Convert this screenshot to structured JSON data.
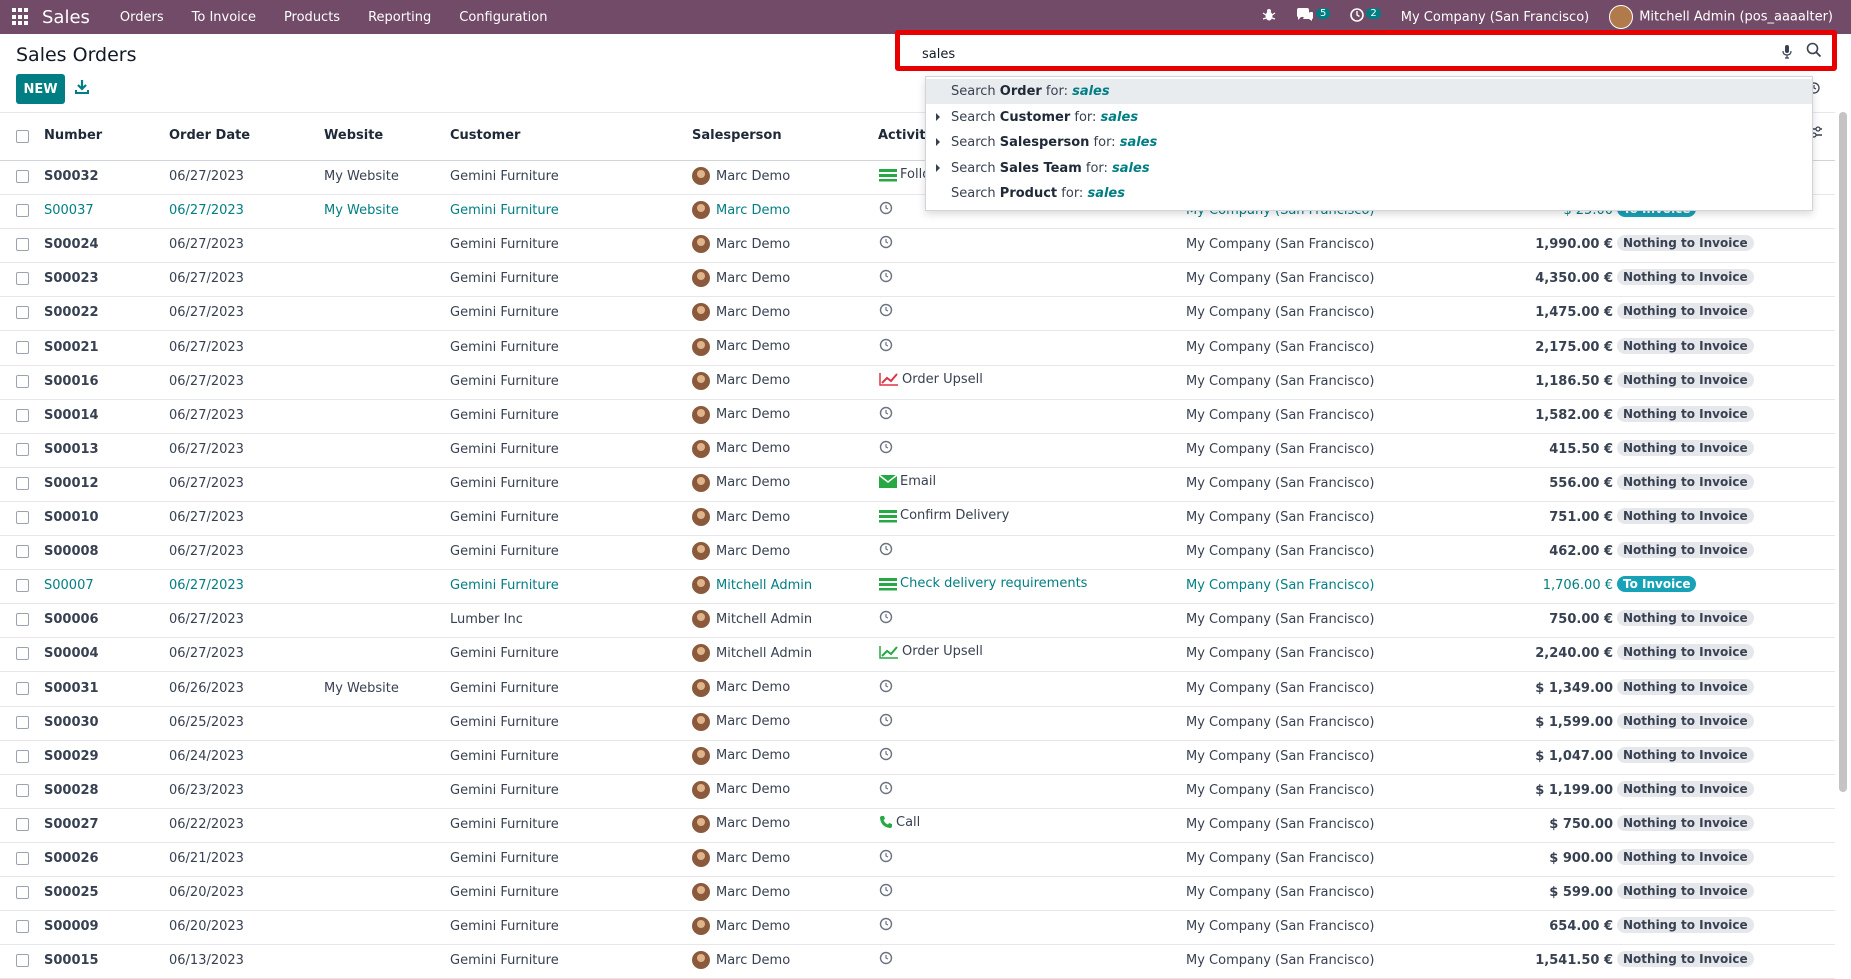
{
  "navbar": {
    "brand": "Sales",
    "menu": [
      "Orders",
      "To Invoice",
      "Products",
      "Reporting",
      "Configuration"
    ],
    "messages_count": "5",
    "activities_count": "2",
    "company": "My Company (San Francisco)",
    "user": "Mitchell Admin (pos_aaaalter)"
  },
  "control": {
    "title": "Sales Orders",
    "new_label": "NEW"
  },
  "search": {
    "value": "sales",
    "suggestions": [
      {
        "prefix": "Search ",
        "field": "Order",
        "suffix": " for: ",
        "query": "sales",
        "expandable": false,
        "active": true
      },
      {
        "prefix": "Search ",
        "field": "Customer",
        "suffix": " for: ",
        "query": "sales",
        "expandable": true,
        "active": false
      },
      {
        "prefix": "Search ",
        "field": "Salesperson",
        "suffix": " for: ",
        "query": "sales",
        "expandable": true,
        "active": false
      },
      {
        "prefix": "Search ",
        "field": "Sales Team",
        "suffix": " for: ",
        "query": "sales",
        "expandable": true,
        "active": false
      },
      {
        "prefix": "Search ",
        "field": "Product",
        "suffix": " for: ",
        "query": "sales",
        "expandable": false,
        "active": false
      }
    ]
  },
  "table": {
    "headers": {
      "number": "Number",
      "date": "Order Date",
      "website": "Website",
      "customer": "Customer",
      "salesperson": "Salesperson",
      "activities": "Activiti"
    },
    "rows": [
      {
        "number": "S00032",
        "date": "06/27/2023",
        "website": "My Website",
        "customer": "Gemini Furniture",
        "salesperson": "Marc Demo",
        "activity": "Follo",
        "act_icon": "list",
        "company": "",
        "total": "",
        "status": "",
        "status_type": "",
        "hl": false
      },
      {
        "number": "S00037",
        "date": "06/27/2023",
        "website": "My Website",
        "customer": "Gemini Furniture",
        "salesperson": "Marc Demo",
        "activity": "",
        "act_icon": "clock",
        "company": "My Company (San Francisco)",
        "total": "$ 25.00",
        "status": "To Invoice",
        "status_type": "toinv",
        "hl": true
      },
      {
        "number": "S00024",
        "date": "06/27/2023",
        "website": "",
        "customer": "Gemini Furniture",
        "salesperson": "Marc Demo",
        "activity": "",
        "act_icon": "clock",
        "company": "My Company (San Francisco)",
        "total": "1,990.00 €",
        "status": "Nothing to Invoice",
        "status_type": "nothing",
        "hl": false
      },
      {
        "number": "S00023",
        "date": "06/27/2023",
        "website": "",
        "customer": "Gemini Furniture",
        "salesperson": "Marc Demo",
        "activity": "",
        "act_icon": "clock",
        "company": "My Company (San Francisco)",
        "total": "4,350.00 €",
        "status": "Nothing to Invoice",
        "status_type": "nothing",
        "hl": false
      },
      {
        "number": "S00022",
        "date": "06/27/2023",
        "website": "",
        "customer": "Gemini Furniture",
        "salesperson": "Marc Demo",
        "activity": "",
        "act_icon": "clock",
        "company": "My Company (San Francisco)",
        "total": "1,475.00 €",
        "status": "Nothing to Invoice",
        "status_type": "nothing",
        "hl": false
      },
      {
        "number": "S00021",
        "date": "06/27/2023",
        "website": "",
        "customer": "Gemini Furniture",
        "salesperson": "Marc Demo",
        "activity": "",
        "act_icon": "clock",
        "company": "My Company (San Francisco)",
        "total": "2,175.00 €",
        "status": "Nothing to Invoice",
        "status_type": "nothing",
        "hl": false
      },
      {
        "number": "S00016",
        "date": "06/27/2023",
        "website": "",
        "customer": "Gemini Furniture",
        "salesperson": "Marc Demo",
        "activity": "Order Upsell",
        "act_icon": "chart-red",
        "company": "My Company (San Francisco)",
        "total": "1,186.50 €",
        "status": "Nothing to Invoice",
        "status_type": "nothing",
        "hl": false
      },
      {
        "number": "S00014",
        "date": "06/27/2023",
        "website": "",
        "customer": "Gemini Furniture",
        "salesperson": "Marc Demo",
        "activity": "",
        "act_icon": "clock",
        "company": "My Company (San Francisco)",
        "total": "1,582.00 €",
        "status": "Nothing to Invoice",
        "status_type": "nothing",
        "hl": false
      },
      {
        "number": "S00013",
        "date": "06/27/2023",
        "website": "",
        "customer": "Gemini Furniture",
        "salesperson": "Marc Demo",
        "activity": "",
        "act_icon": "clock",
        "company": "My Company (San Francisco)",
        "total": "415.50 €",
        "status": "Nothing to Invoice",
        "status_type": "nothing",
        "hl": false
      },
      {
        "number": "S00012",
        "date": "06/27/2023",
        "website": "",
        "customer": "Gemini Furniture",
        "salesperson": "Marc Demo",
        "activity": "Email",
        "act_icon": "email",
        "company": "My Company (San Francisco)",
        "total": "556.00 €",
        "status": "Nothing to Invoice",
        "status_type": "nothing",
        "hl": false
      },
      {
        "number": "S00010",
        "date": "06/27/2023",
        "website": "",
        "customer": "Gemini Furniture",
        "salesperson": "Marc Demo",
        "activity": "Confirm Delivery",
        "act_icon": "list",
        "company": "My Company (San Francisco)",
        "total": "751.00 €",
        "status": "Nothing to Invoice",
        "status_type": "nothing",
        "hl": false
      },
      {
        "number": "S00008",
        "date": "06/27/2023",
        "website": "",
        "customer": "Gemini Furniture",
        "salesperson": "Marc Demo",
        "activity": "",
        "act_icon": "clock",
        "company": "My Company (San Francisco)",
        "total": "462.00 €",
        "status": "Nothing to Invoice",
        "status_type": "nothing",
        "hl": false
      },
      {
        "number": "S00007",
        "date": "06/27/2023",
        "website": "",
        "customer": "Gemini Furniture",
        "salesperson": "Mitchell Admin",
        "activity": "Check delivery requirements",
        "act_icon": "list",
        "company": "My Company (San Francisco)",
        "total": "1,706.00 €",
        "status": "To Invoice",
        "status_type": "toinv",
        "hl": true
      },
      {
        "number": "S00006",
        "date": "06/27/2023",
        "website": "",
        "customer": "Lumber Inc",
        "salesperson": "Mitchell Admin",
        "activity": "",
        "act_icon": "clock",
        "company": "My Company (San Francisco)",
        "total": "750.00 €",
        "status": "Nothing to Invoice",
        "status_type": "nothing",
        "hl": false
      },
      {
        "number": "S00004",
        "date": "06/27/2023",
        "website": "",
        "customer": "Gemini Furniture",
        "salesperson": "Mitchell Admin",
        "activity": "Order Upsell",
        "act_icon": "chart-green",
        "company": "My Company (San Francisco)",
        "total": "2,240.00 €",
        "status": "Nothing to Invoice",
        "status_type": "nothing",
        "hl": false
      },
      {
        "number": "S00031",
        "date": "06/26/2023",
        "website": "My Website",
        "customer": "Gemini Furniture",
        "salesperson": "Marc Demo",
        "activity": "",
        "act_icon": "clock",
        "company": "My Company (San Francisco)",
        "total": "$ 1,349.00",
        "status": "Nothing to Invoice",
        "status_type": "nothing",
        "hl": false
      },
      {
        "number": "S00030",
        "date": "06/25/2023",
        "website": "",
        "customer": "Gemini Furniture",
        "salesperson": "Marc Demo",
        "activity": "",
        "act_icon": "clock",
        "company": "My Company (San Francisco)",
        "total": "$ 1,599.00",
        "status": "Nothing to Invoice",
        "status_type": "nothing",
        "hl": false
      },
      {
        "number": "S00029",
        "date": "06/24/2023",
        "website": "",
        "customer": "Gemini Furniture",
        "salesperson": "Marc Demo",
        "activity": "",
        "act_icon": "clock",
        "company": "My Company (San Francisco)",
        "total": "$ 1,047.00",
        "status": "Nothing to Invoice",
        "status_type": "nothing",
        "hl": false
      },
      {
        "number": "S00028",
        "date": "06/23/2023",
        "website": "",
        "customer": "Gemini Furniture",
        "salesperson": "Marc Demo",
        "activity": "",
        "act_icon": "clock",
        "company": "My Company (San Francisco)",
        "total": "$ 1,199.00",
        "status": "Nothing to Invoice",
        "status_type": "nothing",
        "hl": false
      },
      {
        "number": "S00027",
        "date": "06/22/2023",
        "website": "",
        "customer": "Gemini Furniture",
        "salesperson": "Marc Demo",
        "activity": "Call",
        "act_icon": "phone",
        "company": "My Company (San Francisco)",
        "total": "$ 750.00",
        "status": "Nothing to Invoice",
        "status_type": "nothing",
        "hl": false
      },
      {
        "number": "S00026",
        "date": "06/21/2023",
        "website": "",
        "customer": "Gemini Furniture",
        "salesperson": "Marc Demo",
        "activity": "",
        "act_icon": "clock",
        "company": "My Company (San Francisco)",
        "total": "$ 900.00",
        "status": "Nothing to Invoice",
        "status_type": "nothing",
        "hl": false
      },
      {
        "number": "S00025",
        "date": "06/20/2023",
        "website": "",
        "customer": "Gemini Furniture",
        "salesperson": "Marc Demo",
        "activity": "",
        "act_icon": "clock",
        "company": "My Company (San Francisco)",
        "total": "$ 599.00",
        "status": "Nothing to Invoice",
        "status_type": "nothing",
        "hl": false
      },
      {
        "number": "S00009",
        "date": "06/20/2023",
        "website": "",
        "customer": "Gemini Furniture",
        "salesperson": "Marc Demo",
        "activity": "",
        "act_icon": "clock",
        "company": "My Company (San Francisco)",
        "total": "654.00 €",
        "status": "Nothing to Invoice",
        "status_type": "nothing",
        "hl": false
      },
      {
        "number": "S00015",
        "date": "06/13/2023",
        "website": "",
        "customer": "Gemini Furniture",
        "salesperson": "Marc Demo",
        "activity": "",
        "act_icon": "clock",
        "company": "My Company (San Francisco)",
        "total": "1,541.50 €",
        "status": "Nothing to Invoice",
        "status_type": "nothing",
        "hl": false
      }
    ]
  },
  "colors": {
    "navbar": "#714b67",
    "primary": "#017e84",
    "highlight": "#e80000",
    "to_invoice": "#17a2b8"
  }
}
